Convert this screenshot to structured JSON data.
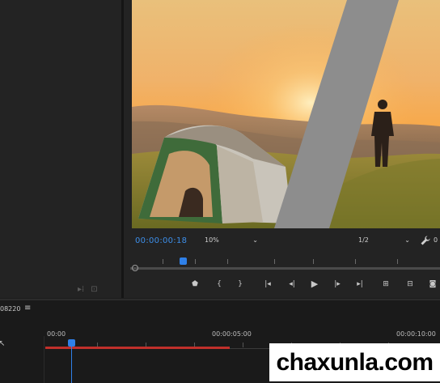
{
  "program_monitor": {
    "timecode": "00:00:00:18",
    "zoom": "10%",
    "quality": "1/2",
    "edge_digit": "0",
    "playhead_fraction": 0.16
  },
  "timeline": {
    "sequence_name": "08220",
    "menu_icon": "hamburger-icon",
    "ruler_times": [
      "00:00",
      "00:00:05:00",
      "00:00:10:00"
    ],
    "playhead_fraction": 0.06
  },
  "transport_icons": [
    "add-marker-icon",
    "mark-in-icon",
    "mark-out-icon",
    "go-to-in-icon",
    "step-back-icon",
    "play-icon",
    "step-forward-icon",
    "go-to-out-icon",
    "lift-icon",
    "extract-icon",
    "export-frame-icon"
  ],
  "watermark": "chaxunla.com",
  "colors": {
    "accent_blue": "#2f80e8",
    "work_area_red": "#c0302b",
    "panel_bg": "#232323"
  }
}
